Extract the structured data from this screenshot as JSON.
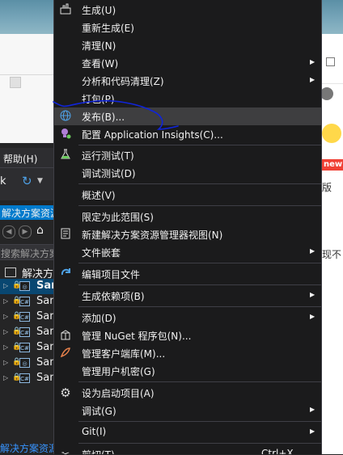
{
  "colors": {
    "menu_background": "#1b1b1c",
    "menu_highlight": "#3e3e40",
    "selection": "#094771",
    "accent": "#007acc",
    "annotation_ink": "#1024d8"
  },
  "vs_window": {
    "menubar_help": "帮助(H)",
    "toolbar_text": "k",
    "solution_explorer_title": "解决方案资源",
    "search_placeholder": "搜索解决方案资",
    "solution_label": "解决方案",
    "projects": [
      {
        "label": "San",
        "icon": "web-project-icon",
        "selected": true
      },
      {
        "label": "San",
        "icon": "csharp-project-icon"
      },
      {
        "label": "San",
        "icon": "csharp-project-icon"
      },
      {
        "label": "San",
        "icon": "csharp-project-icon"
      },
      {
        "label": "San",
        "icon": "csharp-project-icon"
      },
      {
        "label": "San",
        "icon": "web-project-icon"
      },
      {
        "label": "San",
        "icon": "csharp-project-icon"
      }
    ],
    "footer_link": "解决方案资源"
  },
  "right_panel": {
    "badge": "new",
    "text_1": "版",
    "text_2": "现不"
  },
  "context_menu": {
    "build": "生成(U)",
    "rebuild": "重新生成(E)",
    "clean": "清理(N)",
    "view": "查看(W)",
    "analyze": "分析和代码清理(Z)",
    "pack": "打包(P)",
    "publish": "发布(B)...",
    "app_insights": "配置 Application Insights(C)...",
    "run_tests": "运行测试(T)",
    "debug_tests": "调试测试(D)",
    "overview": "概述(V)",
    "scope": "限定为此范围(S)",
    "new_view": "新建解决方案资源管理器视图(N)",
    "file_nesting": "文件嵌套",
    "edit_project": "编辑项目文件",
    "build_deps": "生成依赖项(B)",
    "add": "添加(D)",
    "nuget": "管理 NuGet 程序包(N)...",
    "client_libs": "管理客户端库(M)...",
    "user_secrets": "管理用户机密(G)",
    "set_startup": "设为启动项目(A)",
    "debug": "调试(G)",
    "git": "Git(I)",
    "cut": "剪切(T)",
    "cut_shortcut": "Ctrl+X"
  }
}
